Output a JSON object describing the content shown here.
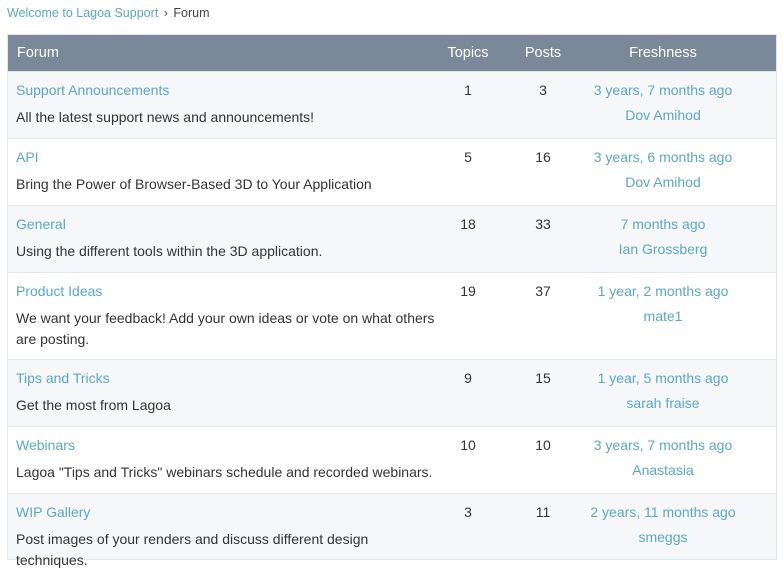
{
  "breadcrumb": {
    "home": "Welcome to Lagoa Support",
    "separator": "›",
    "current": "Forum"
  },
  "header": {
    "forum": "Forum",
    "topics": "Topics",
    "posts": "Posts",
    "freshness": "Freshness"
  },
  "forums": [
    {
      "title": "Support Announcements",
      "description": "All the latest support news and announcements!",
      "topics": "1",
      "posts": "3",
      "freshness": "3 years, 7 months ago",
      "author": "Dov Amihod"
    },
    {
      "title": "API",
      "description": "Bring the Power of Browser-Based 3D to Your Application",
      "topics": "5",
      "posts": "16",
      "freshness": "3 years, 6 months ago",
      "author": "Dov Amihod"
    },
    {
      "title": "General",
      "description": "Using the different tools within the 3D application.",
      "topics": "18",
      "posts": "33",
      "freshness": "7 months ago",
      "author": "Ian Grossberg"
    },
    {
      "title": "Product Ideas",
      "description": "We want your feedback! Add your own ideas or vote on what others are posting.",
      "topics": "19",
      "posts": "37",
      "freshness": "1 year, 2 months ago",
      "author": "mate1"
    },
    {
      "title": "Tips and Tricks",
      "description": "Get the most from Lagoa",
      "topics": "9",
      "posts": "15",
      "freshness": "1 year, 5 months ago",
      "author": "sarah fraise"
    },
    {
      "title": "Webinars",
      "description": "Lagoa \"Tips and Tricks\" webinars schedule and recorded webinars.",
      "topics": "10",
      "posts": "10",
      "freshness": "3 years, 7 months ago",
      "author": "Anastasia"
    },
    {
      "title": "WIP Gallery",
      "description": "Post images of your renders and discuss different design techniques.",
      "topics": "3",
      "posts": "11",
      "freshness": "2 years, 11 months ago",
      "author": "smeggs"
    }
  ],
  "colors": {
    "link": "#5aa7c6",
    "header_bg": "#7b8899",
    "row_alt_bg": "#f6f7f9"
  }
}
